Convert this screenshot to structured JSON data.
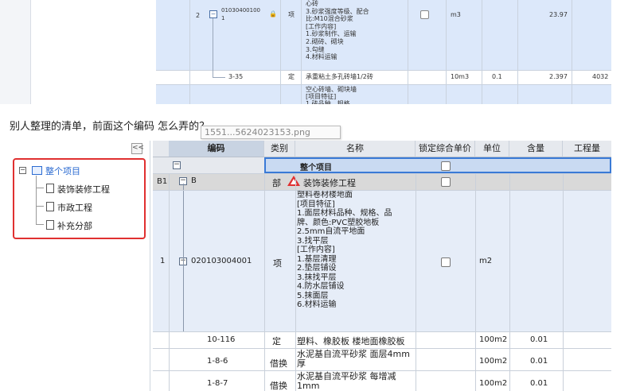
{
  "top": {
    "row_num": "2",
    "code": "01030400100\n1",
    "lock": "🔒",
    "type": "项",
    "desc": "心砖\n3.砂浆强度等级、配合\n比:M10混合砂浆\n[工作内容]\n1.砂浆制作、运输\n2.砌砖、砌块\n3.勾缝\n4.材料运输",
    "unit": "m3",
    "qty": "23.97",
    "sub_code": "3-35",
    "sub_type": "定",
    "sub_name": "承重粘土多孔砖墙1/2砖",
    "sub_unit": "10m3",
    "sub_content": "0.1",
    "sub_qty": "2.397",
    "sub_extra": "4032",
    "next_desc": "空心砖墙、砌块墙\n[项目特征]\n1.砖品种、规格..."
  },
  "caption": "别人整理的清单，前面这个编码 怎么弄的？",
  "tooltip": "1551...5624023153.png",
  "sidebar": {
    "collapse": "<<",
    "root": "整个项目",
    "root_toggle": "⊟",
    "items": [
      "装饰装修工程",
      "市政工程",
      "补充分部"
    ]
  },
  "grid": {
    "headers": [
      "编码",
      "类别",
      "名称",
      "锁定综合单价",
      "单位",
      "含量",
      "工程量"
    ],
    "total_row": {
      "toggle": "−",
      "name": "整个项目"
    },
    "b1_row": {
      "num": "B1",
      "toggle": "−",
      "code": "B",
      "type": "部",
      "name": "装饰装修工程"
    },
    "main_row": {
      "num": "1",
      "toggle": "−",
      "code": "020103004001",
      "type": "项",
      "desc": "塑料卷材楼地面\n[项目特征]\n1.面层材料品种、规格、品\n牌、颜色:PVC塑胶地板\n2.5mm自流平地面\n3.找平层\n[工作内容]\n1.基层清理\n2.垫层铺设\n3.抹找平层\n4.防水层铺设\n5.抹面层\n6.材料运输",
      "unit": "m2"
    },
    "sub_rows": [
      {
        "code": "10-116",
        "type": "定",
        "name": "塑料、橡胶板 楼地面橡胶板",
        "unit": "100m2",
        "content": "0.01"
      },
      {
        "code": "1-8-6",
        "type": "借换",
        "name": "水泥基自流平砂浆 面层4mm\n厚",
        "unit": "100m2",
        "content": "0.01"
      },
      {
        "code": "1-8-7",
        "type": "借换",
        "name": "水泥基自流平砂浆 每增减\n1mm",
        "unit": "100m2",
        "content": "0.01"
      }
    ]
  }
}
